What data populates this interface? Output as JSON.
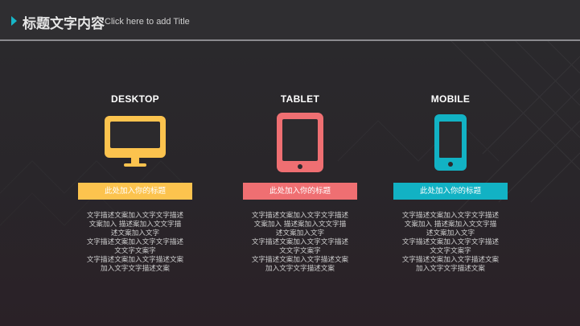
{
  "header": {
    "title": "标题文字内容",
    "subtitle": "Click here to add Title"
  },
  "colors": {
    "accent": "#17b6c7",
    "desktop": "#fcc34e",
    "tablet": "#ef6f72",
    "mobile": "#12b2c4"
  },
  "columns": [
    {
      "title": "DESKTOP",
      "icon": "desktop-monitor-icon",
      "label": "此处加入你的标题",
      "desc": [
        "文字描述文案加入文字文字描述",
        "文案加入    描述案加入文文字描",
        "述文案加入文字",
        "文字描述文案加入文字文字描述",
        "文文字文案字",
        "文字描述文案加入文字描述文案",
        "加入文字文字描述文案"
      ]
    },
    {
      "title": "TABLET",
      "icon": "tablet-icon",
      "label": "此处加入你的标题",
      "desc": [
        "文字描述文案加入文字文字描述",
        "文案加入    描述案加入文文字描",
        "述文案加入文字",
        "文字描述文案加入文字文字描述",
        "文文字文案字",
        "文字描述文案加入文字描述文案",
        "加入文字文字描述文案"
      ]
    },
    {
      "title": "MOBILE",
      "icon": "mobile-phone-icon",
      "label": "此处加入你的标题",
      "desc": [
        "文字描述文案加入文字文字描述",
        "文案加入    描述案加入文文字描",
        "述文案加入文字",
        "文字描述文案加入文字文字描述",
        "文文字文案字",
        "文字描述文案加入文字描述文案",
        "加入文字文字描述文案"
      ]
    }
  ]
}
